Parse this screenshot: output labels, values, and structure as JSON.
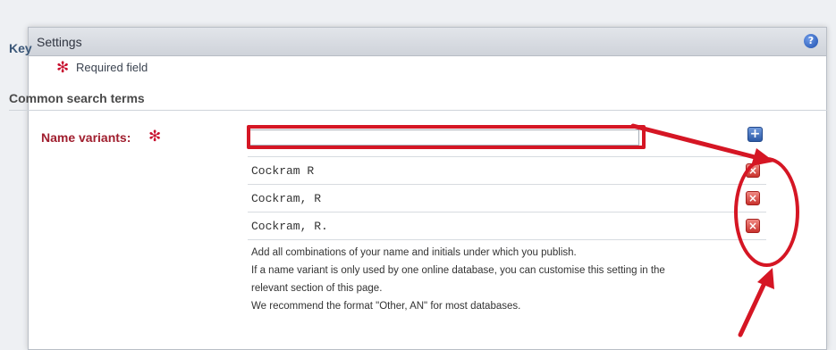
{
  "panel": {
    "title": "Settings",
    "help_icon": "?"
  },
  "key": {
    "heading": "Key",
    "required_star": "✻",
    "required_text": "Required field"
  },
  "section": {
    "heading": "Common search terms"
  },
  "name_variants": {
    "label": "Name variants:",
    "star": "✻",
    "input_value": "",
    "add_button": "+",
    "remove_button": "×",
    "items": [
      {
        "text": "Cockram R"
      },
      {
        "text": "Cockram, R"
      },
      {
        "text": "Cockram, R."
      }
    ],
    "help_lines": [
      "Add all combinations of your name and initials under which you publish.",
      "If a name variant is only used by one online database, you can customise this setting in the",
      "relevant section of this page.",
      "We recommend the format \"Other, AN\" for most databases."
    ]
  },
  "colors": {
    "annotation_red": "#d51624",
    "required_red": "#c8102e",
    "heading_blue": "#3b5778"
  },
  "icons": {
    "help": "help-icon",
    "add": "add-icon",
    "remove": "remove-icon"
  }
}
